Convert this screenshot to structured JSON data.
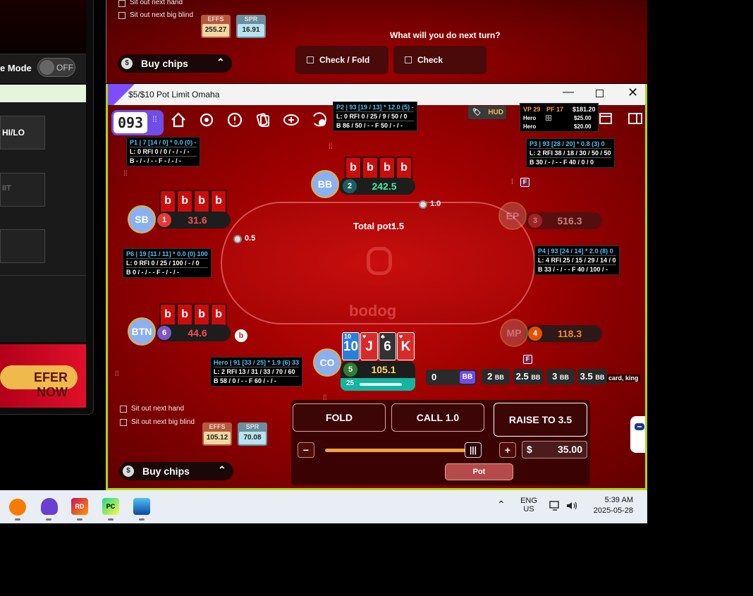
{
  "left_window": {
    "mode_label": "e Mode",
    "toggle_text": "OFF",
    "game_button_1": "HI/LO",
    "game_button_2": "IIT",
    "refer_button": "EFER NOW"
  },
  "back_table": {
    "sit_out_next_hand": "Sit out next hand",
    "sit_out_next_bb": "Sit out next big blind",
    "effs_label": "EFFS",
    "effs_value": "255.27",
    "spr_label": "SPR",
    "spr_value": "16.91",
    "buy_chips": "Buy chips",
    "prompt": "What will you do next turn?",
    "check_fold": "Check / Fold",
    "check": "Check"
  },
  "main_window": {
    "title": "$5/$10 Pot Limit Omaha",
    "hand_counter": "093",
    "hud_button": "HUD",
    "hud_summary": {
      "vp": "VP 29",
      "pf": "PF 17",
      "amount_1": "$181.20",
      "row2_name": "Hero",
      "amount_2": "$25.00",
      "row3_name": "Hero",
      "amount_3": "$20.00"
    },
    "total_pot_label": "Total pot:",
    "total_pot_value": "1.5",
    "bet_sb": "0.5",
    "bet_bb": "1.0",
    "seats": {
      "bb": {
        "label": "BB",
        "num": "2",
        "stack": "242.5"
      },
      "sb": {
        "label": "SB",
        "num": "1",
        "stack": "31.6"
      },
      "ep": {
        "label": "EP",
        "num": "3",
        "stack": "516.3"
      },
      "btn": {
        "label": "BTN",
        "num": "6",
        "stack": "44.6"
      },
      "mp": {
        "label": "MP",
        "num": "4",
        "stack": "118.3"
      },
      "co": {
        "label": "CO",
        "num": "5",
        "stack": "105.1"
      }
    },
    "card_back_glyph": "b",
    "hero_cards": [
      {
        "rank": "10",
        "suit": "♦",
        "color": "#2b7fd6"
      },
      {
        "rank": "J",
        "suit": "♥",
        "color": "#d62b2b"
      },
      {
        "rank": "6",
        "suit": "♣",
        "color": "#333333"
      },
      {
        "rank": "K",
        "suit": "♥",
        "color": "#d62b2b"
      }
    ],
    "hero_timer": "25",
    "hud_p1": {
      "r1": "P1 | 7 [14 / 0] * 0.0 (0) -",
      "r2": "L: 0 RFI 0 / 0 / - / - / -",
      "r3": "B - / - / -  -  F - / - / -"
    },
    "hud_p2": {
      "r1": "P2 | 93 [19 / 13] * 12.0 (5) -",
      "r2": "L: 0 RFI 0 / 25 / 9 / 50 / 0",
      "r3": "B 86 / 50 / -  -  F 50 / - / -"
    },
    "hud_p3": {
      "r1": "P3 | 93 [28 / 20] * 0.8 (3) 0",
      "r2": "L: 2 RFI 38 / 18 / 30 / 50 / 50",
      "r3": "B 30 / - / -  -  F 40 / 0 / 0"
    },
    "hud_p4": {
      "r1": "P4 | 93 [24 / 14] * 2.0 (8) 0",
      "r2": "L: 4 RFI 25 / 15 / 29 / 14 / 0",
      "r3": "B 33 / - / -  -  F 40 / 100 / -"
    },
    "hud_p6": {
      "r1": "P6 | 19 [11 / 11] * 0.0 (0) 100",
      "r2": "L: 0 RFI 0 / 25 / 100 / - / 0",
      "r3": "B 0 / - / -  -  F - / - / -"
    },
    "hud_hero": {
      "r1": "Hero | 91 [33 / 25] * 1.9 (6) 33",
      "r2": "L: 2 RFI 13 / 31 / 33 / 70 / 60",
      "r3": "B 58 / 0 / -  -  F 60 / - / -"
    },
    "badge_f": "F",
    "presets": {
      "current": "0",
      "current_unit": "BB",
      "p1": "2",
      "p2": "2.5",
      "p3": "3",
      "p4": "3.5",
      "unit": "BB"
    },
    "notice": "card, king",
    "sit_out_next_hand": "Sit out next hand",
    "sit_out_next_bb": "Sit out next big blind",
    "effs_label": "EFFS",
    "effs_value": "105.12",
    "spr_label": "SPR",
    "spr_value": "70.08",
    "buy_chips": "Buy chips",
    "fold": "FOLD",
    "call": "CALL 1.0",
    "raise": "RAISE TO 3.5",
    "currency": "$",
    "raise_amount": "35.00",
    "slider_fraction": 1.0,
    "minus": "−",
    "plus": "+",
    "pot_button": "Pot"
  },
  "taskbar": {
    "lang_1": "ENG",
    "lang_2": "US",
    "time": "5:39 AM",
    "date": "2025-05-28"
  },
  "colors": {
    "accent_green": "#b5d21e",
    "felt_red": "#c70a0a",
    "stack_green": "#43f0a0",
    "stack_red": "#ff4d4d",
    "stack_orange": "#ffa23a"
  }
}
